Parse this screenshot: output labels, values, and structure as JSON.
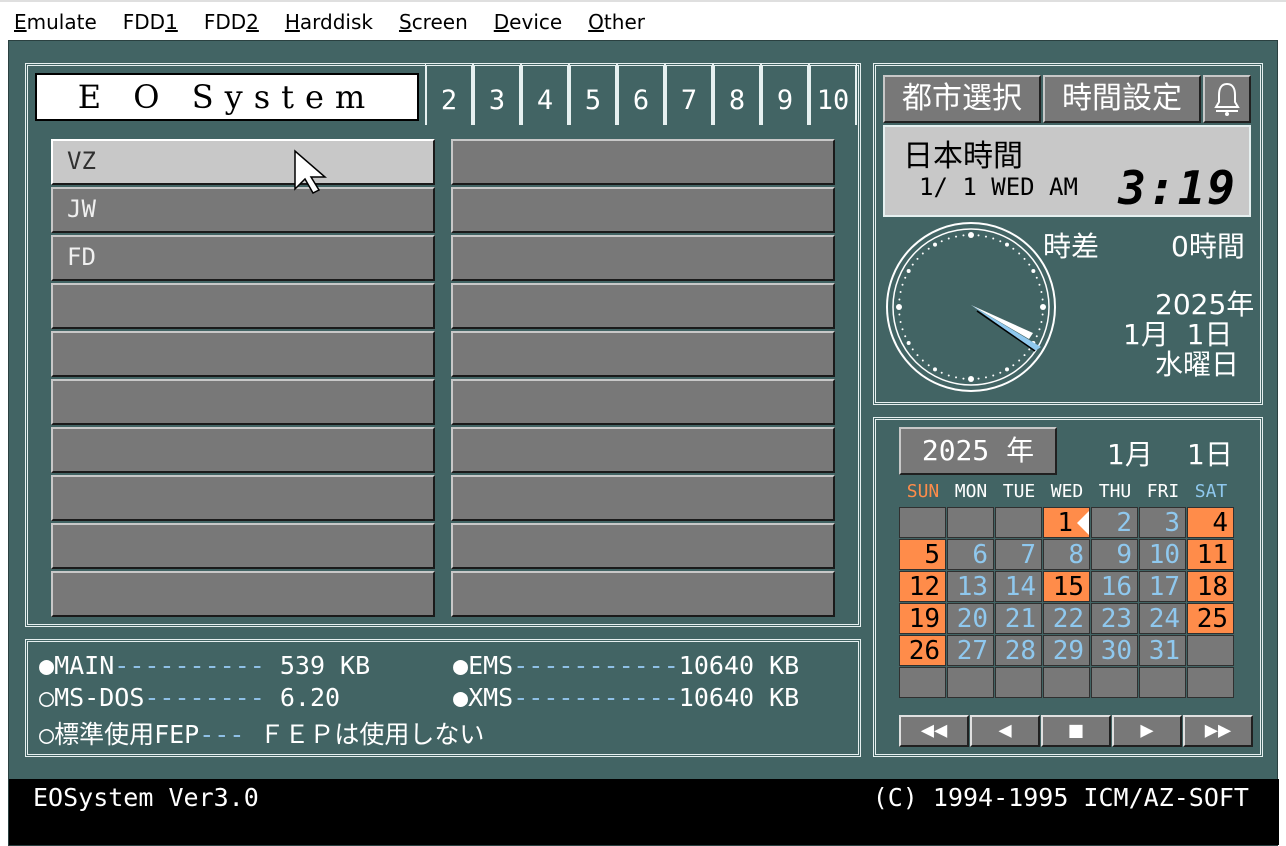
{
  "menu": [
    {
      "first": "E",
      "rest": "mulate"
    },
    {
      "first": "",
      "rest": "FDD",
      "tail": "1"
    },
    {
      "first": "",
      "rest": "FDD",
      "tail": "2"
    },
    {
      "first": "H",
      "rest": "arddisk"
    },
    {
      "first": "S",
      "rest": "creen"
    },
    {
      "first": "D",
      "rest": "evice"
    },
    {
      "first": "O",
      "rest": "ther"
    }
  ],
  "title": "E O System",
  "tabs": [
    "2",
    "3",
    "4",
    "5",
    "6",
    "7",
    "8",
    "9",
    "10"
  ],
  "list_left": [
    "VZ",
    "JW",
    "FD",
    "",
    "",
    "",
    "",
    "",
    "",
    ""
  ],
  "list_right": [
    "",
    "",
    "",
    "",
    "",
    "",
    "",
    "",
    "",
    ""
  ],
  "memory": {
    "main_label": "MAIN",
    "main_dash": "----------",
    "main_value": " 539 KB",
    "msdos_label": "MS-DOS",
    "msdos_dash": "--------",
    "msdos_value": " 6.20",
    "fep_label": "標準使用FEP",
    "fep_dash": "---",
    "fep_value": " ＦＥＰは使用しない",
    "ems_label": "EMS",
    "ems_dash": "-----------",
    "ems_value": "10640 KB",
    "xms_label": "XMS",
    "xms_dash": "-----------",
    "xms_value": "10640 KB"
  },
  "clock_panel": {
    "city_button": "都市選択",
    "time_button": "時間設定",
    "tz_name": "日本時間",
    "tz_date": "1/ 1 WED AM",
    "tz_time": "3:19",
    "diff_label": "時差",
    "diff_value": "0時間",
    "year": "2025年",
    "month_day": "1月  1日",
    "weekday": "水曜日"
  },
  "calendar": {
    "year_label": "2025 年",
    "month_label": "1月",
    "day_label": "1日",
    "days_of_week": [
      "SUN",
      "MON",
      "TUE",
      "WED",
      "THU",
      "FRI",
      "SAT"
    ],
    "weeks": [
      [
        "",
        "",
        "",
        "1",
        "2",
        "3",
        "4"
      ],
      [
        "5",
        "6",
        "7",
        "8",
        "9",
        "10",
        "11"
      ],
      [
        "12",
        "13",
        "14",
        "15",
        "16",
        "17",
        "18"
      ],
      [
        "19",
        "20",
        "21",
        "22",
        "23",
        "24",
        "25"
      ],
      [
        "26",
        "27",
        "28",
        "29",
        "30",
        "31",
        ""
      ],
      [
        "",
        "",
        "",
        "",
        "",
        "",
        ""
      ]
    ],
    "nav_buttons": [
      "◀◀",
      "◀",
      "■",
      "▶",
      "▶▶"
    ]
  },
  "colors": {
    "background": "#426464",
    "sunday": "#ff8c4a",
    "saturday": "#8fc8ee",
    "holiday_cell": "#ff8c4a",
    "weekday_number": "#8fc8ee"
  },
  "status": {
    "left": "EOSystem Ver3.0",
    "right": "(C) 1994-1995 ICM/AZ-SOFT"
  }
}
